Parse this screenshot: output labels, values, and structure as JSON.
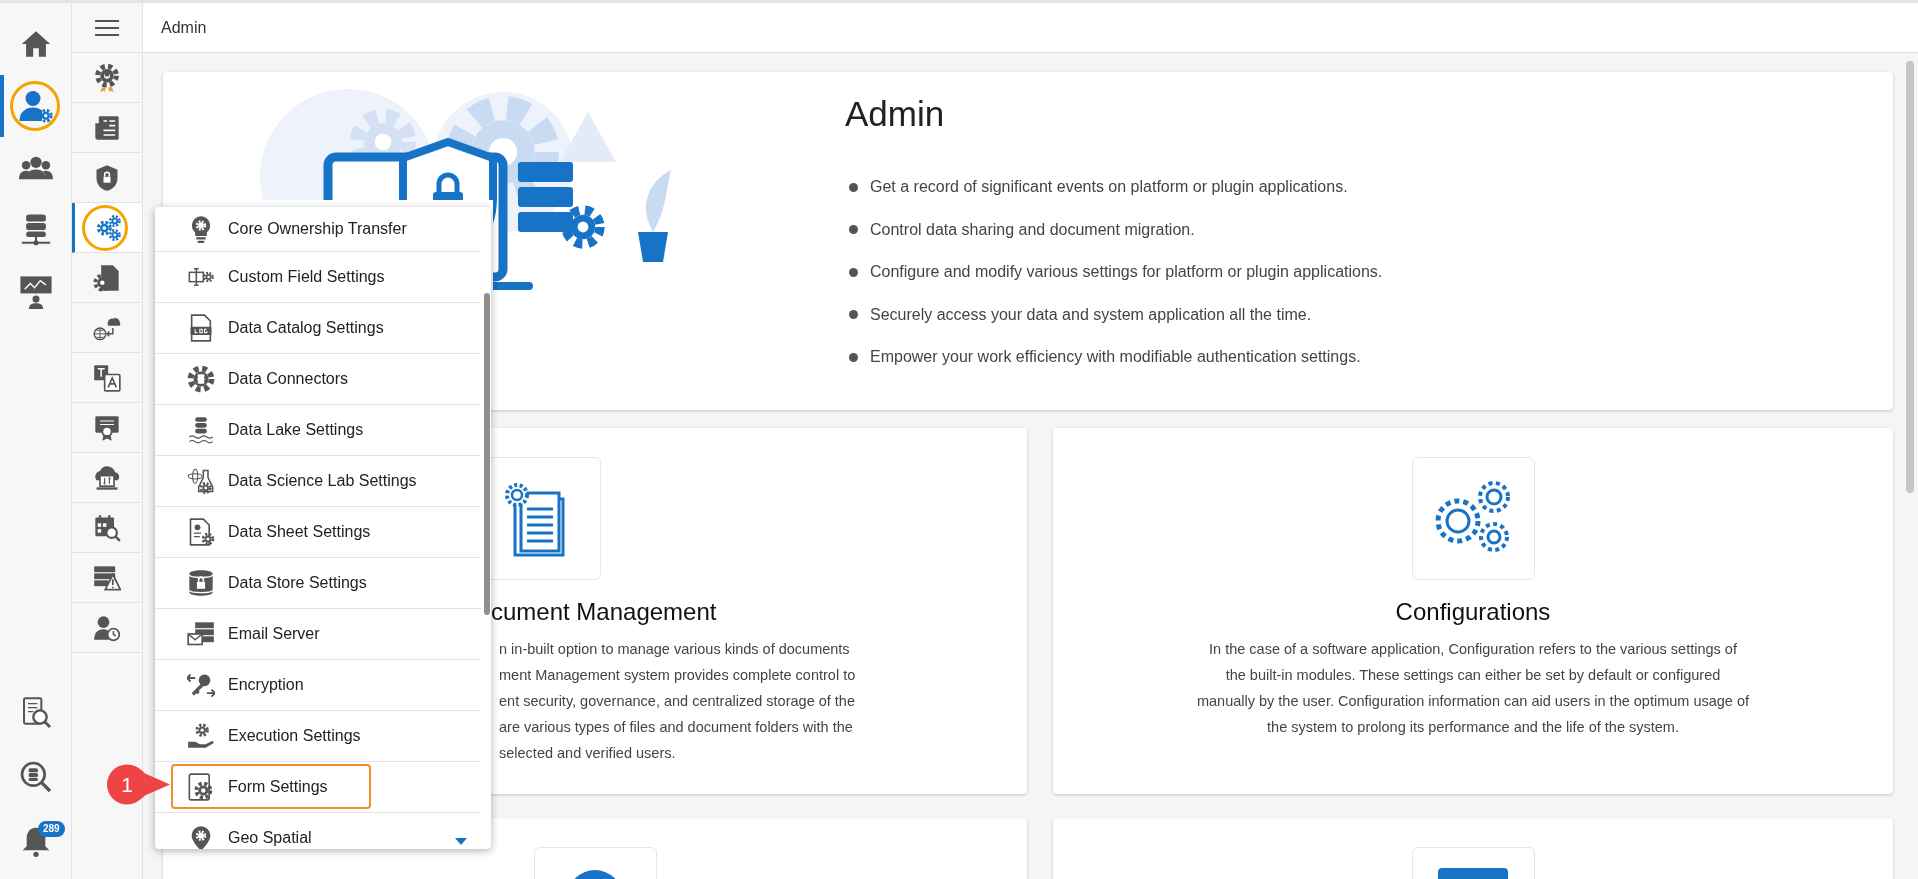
{
  "top_bar": {
    "title": "Admin"
  },
  "primary_nav": {
    "top": [
      {
        "kind": "home",
        "selected": false,
        "highlighted": false
      },
      {
        "kind": "user-gear",
        "selected": true,
        "highlighted": true
      },
      {
        "kind": "users",
        "selected": false,
        "highlighted": false
      },
      {
        "kind": "database",
        "selected": false,
        "highlighted": false
      },
      {
        "kind": "presentation",
        "selected": false,
        "highlighted": false
      }
    ],
    "bottom": [
      {
        "kind": "doc-search"
      },
      {
        "kind": "db-search"
      },
      {
        "kind": "bell",
        "badge": "289"
      }
    ]
  },
  "secondary_nav": [
    {
      "kind": "award",
      "selected": false,
      "highlighted": false
    },
    {
      "kind": "invoice",
      "selected": false,
      "highlighted": false
    },
    {
      "kind": "shield",
      "selected": false,
      "highlighted": false
    },
    {
      "kind": "gears",
      "selected": true,
      "highlighted": true
    },
    {
      "kind": "doc-gear",
      "selected": false,
      "highlighted": false
    },
    {
      "kind": "globe-cloud",
      "selected": false,
      "highlighted": false
    },
    {
      "kind": "translate",
      "selected": false,
      "highlighted": false
    },
    {
      "kind": "certificate",
      "selected": false,
      "highlighted": false
    },
    {
      "kind": "cloud-monitor",
      "selected": false,
      "highlighted": false
    },
    {
      "kind": "calendar-search",
      "selected": false,
      "highlighted": false
    },
    {
      "kind": "server-warning",
      "selected": false,
      "highlighted": false
    },
    {
      "kind": "user-clock",
      "selected": false,
      "highlighted": false
    }
  ],
  "dropdown": {
    "callout": "1",
    "items": [
      {
        "label": "Core Ownership Transfer",
        "kind": "bulb",
        "highlighted": false
      },
      {
        "label": "Custom Field Settings",
        "kind": "field",
        "highlighted": false
      },
      {
        "label": "Data Catalog Settings",
        "kind": "log",
        "highlighted": false
      },
      {
        "label": "Data Connectors",
        "kind": "gear-db",
        "highlighted": false
      },
      {
        "label": "Data Lake Settings",
        "kind": "lake",
        "highlighted": false
      },
      {
        "label": "Data Science Lab Settings",
        "kind": "flask",
        "highlighted": false
      },
      {
        "label": "Data Sheet Settings",
        "kind": "sheet",
        "highlighted": false
      },
      {
        "label": "Data Store Settings",
        "kind": "db-lock",
        "highlighted": false
      },
      {
        "label": "Email Server",
        "kind": "mail",
        "highlighted": false
      },
      {
        "label": "Encryption",
        "kind": "key",
        "highlighted": false
      },
      {
        "label": "Execution Settings",
        "kind": "hand",
        "highlighted": false
      },
      {
        "label": "Form Settings",
        "kind": "form",
        "highlighted": true
      },
      {
        "label": "Geo Spatial",
        "kind": "pin",
        "highlighted": false
      }
    ]
  },
  "hero": {
    "title": "Admin",
    "bullets": [
      "Get a record of significant events on platform or plugin applications.",
      "Control data sharing and document migration.",
      "Configure and modify various settings for platform or plugin applications.",
      "Securely access your data and system application all the time.",
      "Empower your work efficiency with modifiable authentication settings."
    ]
  },
  "cards": [
    {
      "kind": "documents",
      "title": "cument Management",
      "lines": [
        "n in-built option to manage various kinds of documents",
        "ment Management system provides complete control to",
        "ent security, governance, and centralized storage of the",
        "are various types of files and document folders with the",
        "selected and verified users."
      ]
    },
    {
      "kind": "configurations",
      "title": "Configurations",
      "lines": [
        "In the case of a software application, Configuration refers to the various settings of",
        "the built-in modules. These settings can either be set by default or configured",
        "manually by the user. Configuration information can aid users in the optimum usage of",
        "the system to prolong its performance and the life of the system."
      ]
    },
    {
      "kind": "circle"
    },
    {
      "kind": "square"
    }
  ]
}
